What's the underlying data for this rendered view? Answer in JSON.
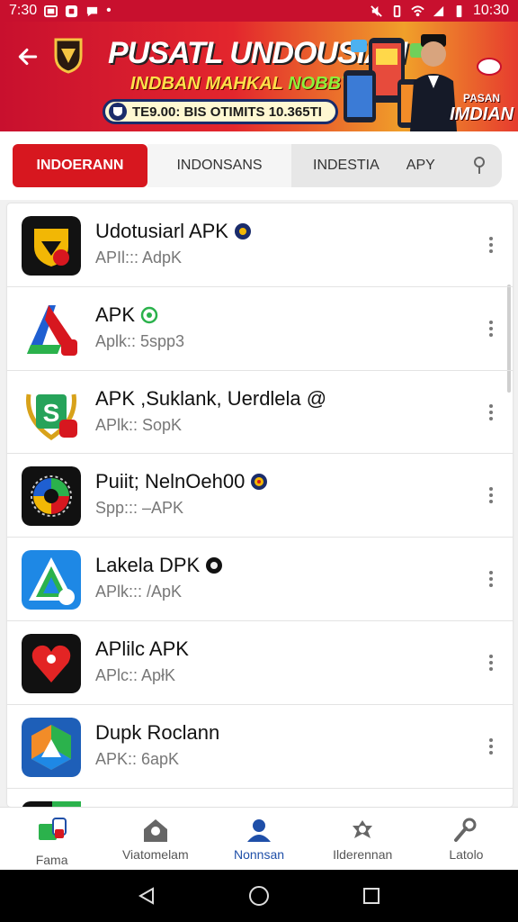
{
  "status_bar": {
    "time_left": "7:30",
    "time_right": "10:30"
  },
  "banner": {
    "title": "PUSATL UNDOUSIAN",
    "subtitle": "INDBAN MAHKAL",
    "subtitle_accent": "NOBBY 8",
    "pill_text": "TE9.00: BIS OTIMITS 10.365TI",
    "side_small": "PASAN",
    "side_main": "IMDIAN"
  },
  "tabs": [
    {
      "label": "INDOERANN",
      "active": true
    },
    {
      "label": "INDONSANS",
      "active": false
    },
    {
      "label": "INDESTIA",
      "active": false
    },
    {
      "label": "APY",
      "active": false
    }
  ],
  "apps": [
    {
      "name": "Udotusiarl APK",
      "sub": "APIl::: AdpK",
      "icon": "shield-mask-icon",
      "badge": "dark-badge"
    },
    {
      "name": "APK",
      "sub": "Aplk:: 5spp3",
      "icon": "blue-a-icon",
      "badge": "green-badge"
    },
    {
      "name": "APK ,Suklank, Uerdlela @",
      "sub": "APlk:: SopK",
      "icon": "green-s-icon",
      "badge": ""
    },
    {
      "name": "Puiit; NelnOeh00",
      "sub": "Spp::: –APK",
      "icon": "colorful-circle-icon",
      "badge": "flag-badge"
    },
    {
      "name": "Lakela DPK",
      "sub": "APlk::: /ApK",
      "icon": "blue-a-triangle-icon",
      "badge": "dark-badge"
    },
    {
      "name": "APlilc APK",
      "sub": "APlc:: ApłK",
      "icon": "red-heart-icon",
      "badge": ""
    },
    {
      "name": "Dupk Roclann",
      "sub": "APK:: 6apK",
      "icon": "colorful-hexagon-icon",
      "badge": ""
    }
  ],
  "bottom_nav": [
    {
      "label": "Fama",
      "icon": "apps-icon",
      "active": false
    },
    {
      "label": "Viatomelam",
      "icon": "home-person-icon",
      "active": false
    },
    {
      "label": "Nonnsan",
      "icon": "person-icon",
      "active": true
    },
    {
      "label": "Ilderennan",
      "icon": "group-icon",
      "active": false
    },
    {
      "label": "Latolo",
      "icon": "wrench-icon",
      "active": false
    }
  ],
  "colors": {
    "primary_red": "#d7171f",
    "active_blue": "#1f4fa8"
  }
}
